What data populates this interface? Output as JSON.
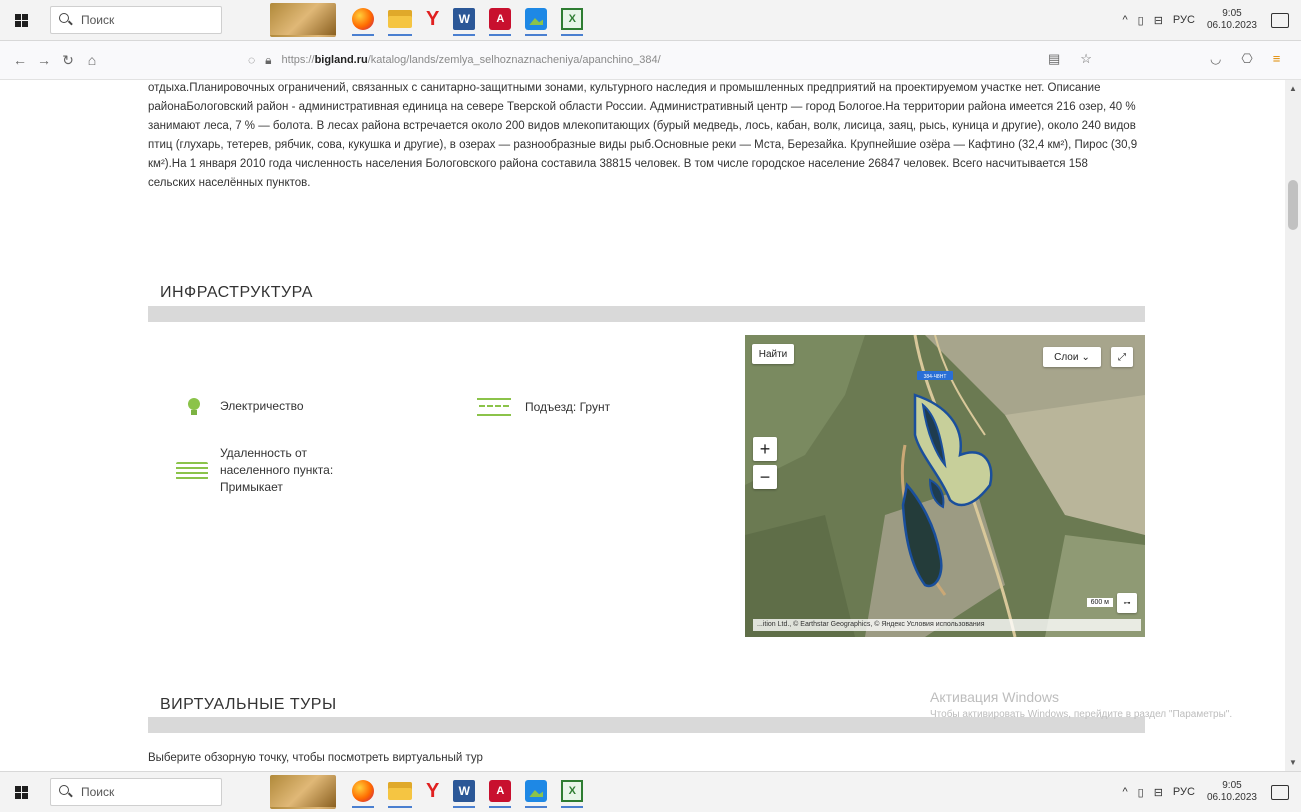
{
  "taskbar": {
    "search_placeholder": "Поиск",
    "apps": [
      "photo-app",
      "firefox",
      "file-explorer",
      "yandex-browser",
      "word",
      "pdf-reader",
      "photos",
      "spreadsheet"
    ],
    "app_glyphs": {
      "yandex": "Y",
      "word": "W",
      "pdf": "A",
      "excel": "X"
    },
    "tray": {
      "caret": "^",
      "lang": "РУС",
      "time": "9:05",
      "date": "06.10.2023"
    }
  },
  "browser": {
    "url_prefix": "https://",
    "url_domain": "bigland.ru",
    "url_path": "/katalog/lands/zemlya_selhoznaznacheniya/apanchino_384/"
  },
  "description": {
    "text": "отдыха.Планировочных ограничений, связанных с санитарно-защитными зонами, культурного наследия и промышленных предприятий на проектируемом участке нет. Описание районаБологовский район - административная единица на севере Тверской области России. Административный центр — город Бологое.На территории района имеется 216 озер, 40 % занимают леса, 7 % — болота. В лесах района встречается около 200 видов млекопитающих (бурый медведь, лось, кабан, волк, лисица, заяц, рысь, куница и другие), около 240 видов птиц (глухарь, тетерев, рябчик, сова, кукушка и другие), в озерах — разнообразные виды рыб.Основные реки — Мста, Березайка. Крупнейшие озёра — Кафтино (32,4 км²), Пирос (30,9 км²).На 1 января 2010 года численность населения Бологовского района составила 38815 человек. В том числе городское население 26847 человек. Всего насчитывается 158 сельских населённых пунктов."
  },
  "infrastructure": {
    "title": "ИНФРАСТРУКТУРА",
    "items": [
      {
        "icon": "lightbulb-icon",
        "label": "Электричество"
      },
      {
        "icon": "road-icon",
        "label": "Подъезд: Грунт"
      },
      {
        "icon": "water-waves-icon",
        "label": "Удаленность от населенного пункта: Примыкает"
      }
    ]
  },
  "map": {
    "find_button": "Найти",
    "layers_button": "Слои",
    "zoom_in": "+",
    "zoom_out": "−",
    "label_tag": "384-Ч8НT",
    "scale": "600 м",
    "attribution": "...ition Ltd., © Earthstar Geographics, © Яндекс Условия использования"
  },
  "tours": {
    "title": "ВИРТУАЛЬНЫЕ ТУРЫ",
    "hint": "Выберите обзорную точку, чтобы посмотреть виртуальный тур"
  },
  "watermark": {
    "line1": "Активация Windows",
    "line2": "Чтобы активировать Windows, перейдите в раздел \"Параметры\"."
  },
  "colors": {
    "accent_green": "#8bc34a",
    "section_bar": "#d9d9d9",
    "plot_outline": "#1a4f9c"
  }
}
